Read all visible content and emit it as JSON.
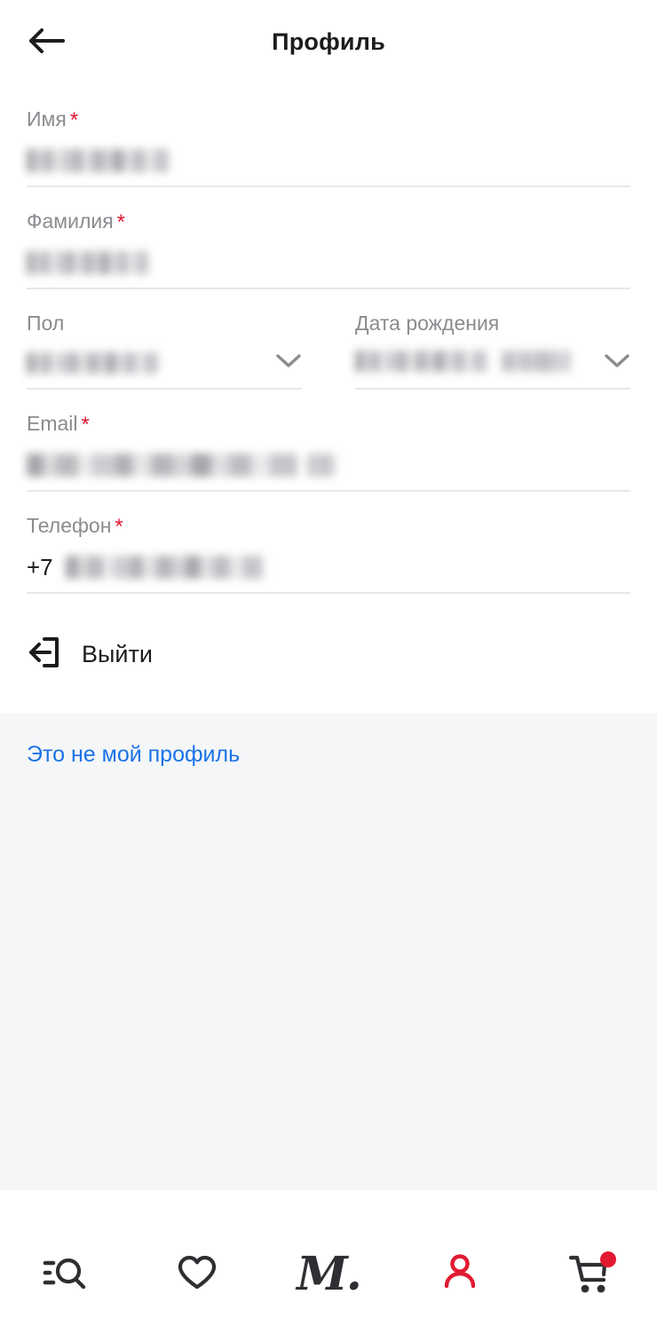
{
  "header": {
    "title": "Профиль",
    "back_icon": "arrow-left-icon"
  },
  "form": {
    "fields": [
      {
        "id": "first-name",
        "label": "Имя",
        "required": true,
        "required_mark": "*",
        "value": "",
        "redacted": true
      },
      {
        "id": "last-name",
        "label": "Фамилия",
        "required": true,
        "required_mark": "*",
        "value": "",
        "redacted": true
      },
      {
        "id": "gender",
        "label": "Пол",
        "required": false,
        "value": "",
        "redacted": true,
        "control": "select",
        "chevron_icon": "chevron-down-icon"
      },
      {
        "id": "birth-date",
        "label": "Дата рождения",
        "required": false,
        "value": "",
        "redacted": true,
        "control": "select",
        "chevron_icon": "chevron-down-icon"
      },
      {
        "id": "email",
        "label": "Email",
        "required": true,
        "required_mark": "*",
        "value": "",
        "redacted": true
      },
      {
        "id": "phone",
        "label": "Телефон",
        "required": true,
        "required_mark": "*",
        "prefix": "+7",
        "value": "",
        "redacted": true
      }
    ]
  },
  "actions": {
    "logout_label": "Выйти",
    "logout_icon": "logout-icon",
    "not_my_profile_label": "Это не мой профиль"
  },
  "bottom_nav": {
    "items": [
      {
        "id": "catalog",
        "icon": "search-list-icon",
        "active": false
      },
      {
        "id": "favorites",
        "icon": "heart-icon",
        "active": false
      },
      {
        "id": "home",
        "icon": "logo-m-icon",
        "label": "М.",
        "active": false
      },
      {
        "id": "profile",
        "icon": "person-icon",
        "active": true
      },
      {
        "id": "cart",
        "icon": "cart-icon",
        "active": false,
        "badge": true
      }
    ]
  },
  "colors": {
    "accent_red": "#e11931",
    "link_blue": "#1a73e8",
    "label_gray": "#8b8b90",
    "icon_dark": "#2f2f33",
    "panel_gray": "#f5f6f8",
    "divider": "#e6e7e9"
  }
}
